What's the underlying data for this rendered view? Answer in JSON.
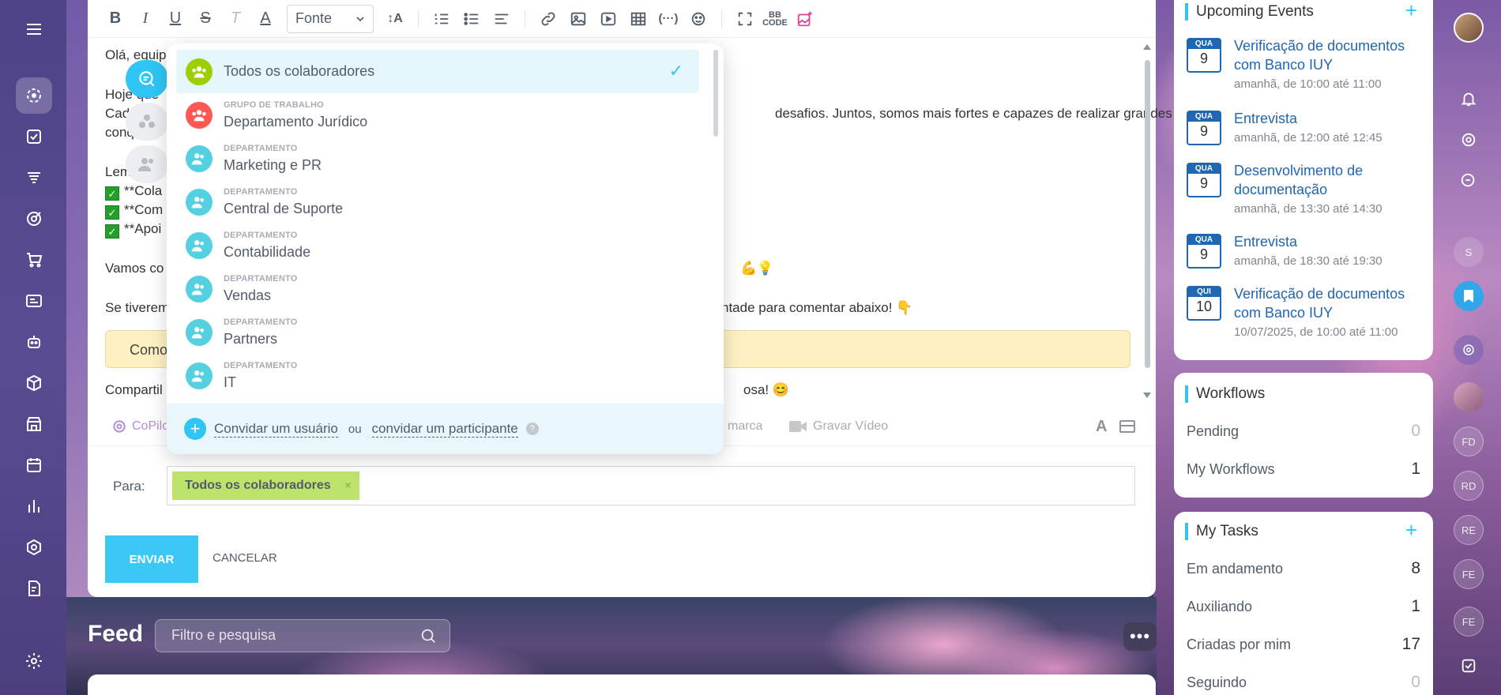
{
  "toolbar": {
    "font_label": "Fonte",
    "code_label": "BB CODE"
  },
  "editor": {
    "line1": "Olá, equip",
    "line2": "Hoje que",
    "line3a": "Cad",
    "line3b": "desafios. Juntos, somos mais fortes e capazes de realizar grandes",
    "line4": "conq",
    "line5": "Lem",
    "check1": "**Cola",
    "check2": "**Com",
    "check3": "**Apoi",
    "line6": "Vamos co",
    "line7a": "Se tiverem",
    "line7b": "ntade para comentar abaixo! 👇",
    "quote": "Como",
    "line8a": "Compartil",
    "line8b": "osa! 😊",
    "emoji_tail": "💪💡"
  },
  "bottom_tools": {
    "copilot": "CoPilo",
    "marca": "marca",
    "video": "Gravar Vídeo",
    "font_a": "A"
  },
  "recipients": {
    "label": "Para:",
    "chip": "Todos os colaboradores",
    "chip_remove": "×"
  },
  "actions": {
    "send": "ENVIAR",
    "cancel": "CANCELAR"
  },
  "dropdown": {
    "items": [
      {
        "type": "",
        "name": "Todos os colaboradores",
        "color": "#9dcf00",
        "selected": true
      },
      {
        "type": "GRUPO DE TRABALHO",
        "name": "Departamento Jurídico",
        "color": "#ff5752"
      },
      {
        "type": "DEPARTAMENTO",
        "name": "Marketing e PR",
        "color": "#55d0e0"
      },
      {
        "type": "DEPARTAMENTO",
        "name": "Central de Suporte",
        "color": "#55d0e0"
      },
      {
        "type": "DEPARTAMENTO",
        "name": "Contabilidade",
        "color": "#55d0e0"
      },
      {
        "type": "DEPARTAMENTO",
        "name": "Vendas",
        "color": "#55d0e0"
      },
      {
        "type": "DEPARTAMENTO",
        "name": "Partners",
        "color": "#55d0e0"
      },
      {
        "type": "DEPARTAMENTO",
        "name": "IT",
        "color": "#55d0e0"
      }
    ],
    "invite_user": "Convidar um usuário",
    "or": "ou",
    "invite_participant": "convidar um participante",
    "help": "?",
    "check": "✓",
    "plus": "+"
  },
  "feed": {
    "title": "Feed",
    "search_placeholder": "Filtro e pesquisa",
    "more": "•••"
  },
  "events": {
    "title": "Upcoming Events",
    "add": "+",
    "items": [
      {
        "day_name": "QUA",
        "day": "9",
        "title_1": "Verificação de documentos",
        "title_2": "com Banco IUY",
        "time": "amanhã, de 10:00 até 11:00"
      },
      {
        "day_name": "QUA",
        "day": "9",
        "title_1": "Entrevista",
        "title_2": "",
        "time": "amanhã, de 12:00 até 12:45"
      },
      {
        "day_name": "QUA",
        "day": "9",
        "title_1": "Desenvolvimento de",
        "title_2": "documentação",
        "time": "amanhã, de 13:30 até 14:30"
      },
      {
        "day_name": "QUA",
        "day": "9",
        "title_1": "Entrevista",
        "title_2": "",
        "time": "amanhã, de 18:30 até 19:30"
      },
      {
        "day_name": "QUI",
        "day": "10",
        "title_1": "Verificação de documentos",
        "title_2": "com Banco IUY",
        "time": "10/07/2025, de 10:00 até 11:00"
      }
    ]
  },
  "workflows": {
    "title": "Workflows",
    "rows": [
      {
        "label": "Pending",
        "value": "0"
      },
      {
        "label": "My Workflows",
        "value": "1"
      }
    ]
  },
  "tasks": {
    "title": "My Tasks",
    "add": "+",
    "rows": [
      {
        "label": "Em andamento",
        "value": "8"
      },
      {
        "label": "Auxiliando",
        "value": "1"
      },
      {
        "label": "Criadas por mim",
        "value": "17"
      },
      {
        "label": "Seguindo",
        "value": "0"
      }
    ]
  },
  "rail": {
    "initials": [
      "S",
      "FD",
      "RD",
      "RE",
      "FE",
      "FE"
    ]
  }
}
